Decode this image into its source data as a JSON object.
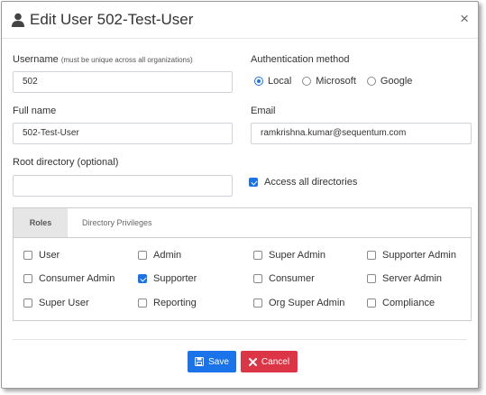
{
  "dialog": {
    "title": "Edit User 502-Test-User",
    "close_symbol": "×"
  },
  "form": {
    "username_label": "Username",
    "username_hint": "(must be unique across all organizations)",
    "username_value": "502",
    "auth_label": "Authentication method",
    "auth_options": [
      {
        "label": "Local",
        "selected": true
      },
      {
        "label": "Microsoft",
        "selected": false
      },
      {
        "label": "Google",
        "selected": false
      }
    ],
    "fullname_label": "Full name",
    "fullname_value": "502-Test-User",
    "email_label": "Email",
    "email_value": "ramkrishna.kumar@sequentum.com",
    "rootdir_label": "Root directory (optional)",
    "rootdir_value": "",
    "access_all_label": "Access all directories",
    "access_all_checked": true
  },
  "tabs": [
    {
      "label": "Roles",
      "active": true
    },
    {
      "label": "Directory Privileges",
      "active": false
    }
  ],
  "roles": [
    {
      "label": "User",
      "checked": false
    },
    {
      "label": "Admin",
      "checked": false
    },
    {
      "label": "Super Admin",
      "checked": false
    },
    {
      "label": "Supporter Admin",
      "checked": false
    },
    {
      "label": "Consumer Admin",
      "checked": false
    },
    {
      "label": "Supporter",
      "checked": true
    },
    {
      "label": "Consumer",
      "checked": false
    },
    {
      "label": "Server Admin",
      "checked": false
    },
    {
      "label": "Super User",
      "checked": false
    },
    {
      "label": "Reporting",
      "checked": false
    },
    {
      "label": "Org Super Admin",
      "checked": false
    },
    {
      "label": "Compliance",
      "checked": false
    }
  ],
  "buttons": {
    "save_label": "Save",
    "cancel_label": "Cancel"
  },
  "colors": {
    "primary": "#1a73e8",
    "danger": "#dc3545"
  },
  "icons": {
    "title": "user-icon",
    "close": "close-icon",
    "save": "floppy-disk-icon",
    "cancel": "x-mark-icon"
  }
}
